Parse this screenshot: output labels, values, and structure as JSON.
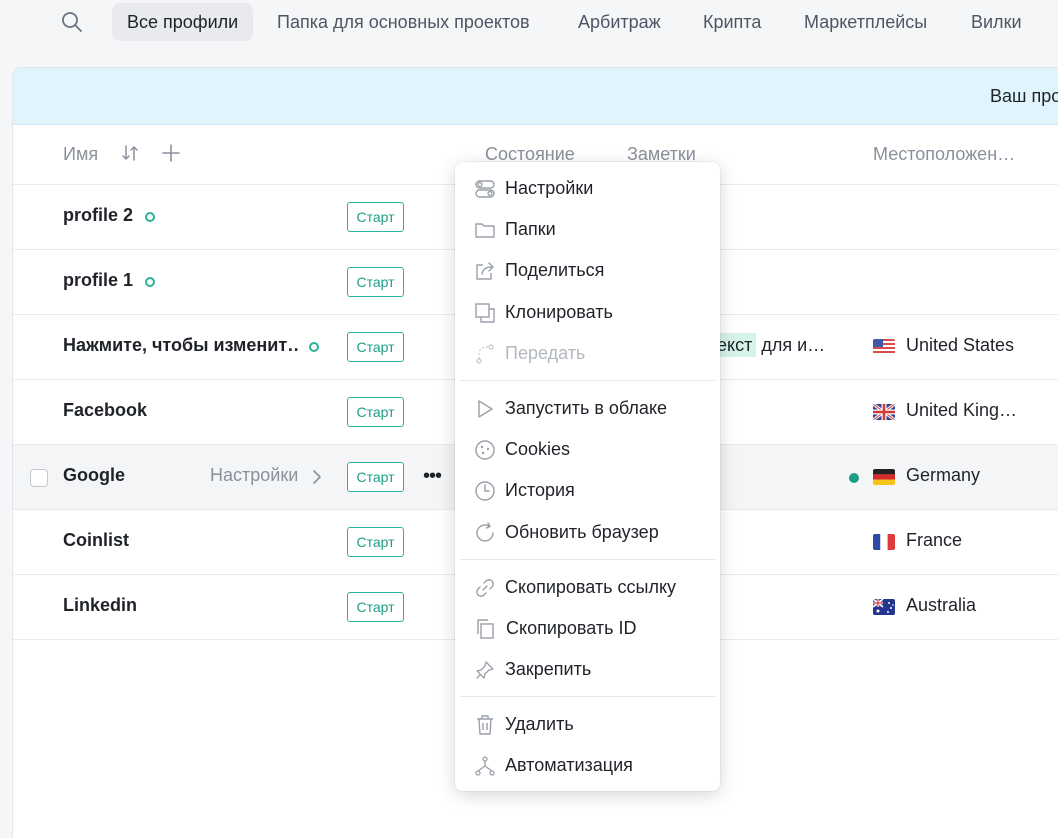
{
  "tabs": [
    {
      "label": "Все профили",
      "active": true
    },
    {
      "label": "Папка для основных проектов"
    },
    {
      "label": "Арбитраж"
    },
    {
      "label": "Крипта"
    },
    {
      "label": "Маркетплейсы"
    },
    {
      "label": "Вилки"
    }
  ],
  "banner": {
    "text": "Ваш про"
  },
  "table": {
    "headers": {
      "name": "Имя",
      "state": "Состояние",
      "notes": "Заметки",
      "location": "Местоположен…"
    },
    "start_label": "Старт",
    "row_settings_label": "Настройки",
    "more_label": "•••",
    "rows": [
      {
        "name": "profile 2",
        "location": ""
      },
      {
        "name": "profile 1",
        "location": ""
      },
      {
        "name": "Нажмите, чтобы изменит…",
        "note_highlight": "текст",
        "note_rest": " для и…",
        "location": "United States"
      },
      {
        "name": "Facebook",
        "location": "United King…"
      },
      {
        "name": "Google",
        "location": "Germany"
      },
      {
        "name": "Coinlist",
        "location": "France"
      },
      {
        "name": "Linkedin",
        "location": "Australia"
      }
    ]
  },
  "context_menu": {
    "items": [
      {
        "label": "Настройки",
        "icon": "settings-toggle-icon"
      },
      {
        "label": "Папки",
        "icon": "folder-icon"
      },
      {
        "label": "Поделиться",
        "icon": "share-icon"
      },
      {
        "label": "Клонировать",
        "icon": "clone-icon"
      },
      {
        "label": "Передать",
        "icon": "transfer-icon",
        "disabled": true
      },
      {
        "label": "Запустить в облаке",
        "icon": "play-icon"
      },
      {
        "label": "Cookies",
        "icon": "cookie-icon"
      },
      {
        "label": "История",
        "icon": "clock-icon"
      },
      {
        "label": "Обновить браузер",
        "icon": "refresh-icon"
      },
      {
        "label": "Скопировать ссылку",
        "icon": "link-icon"
      },
      {
        "label": "Скопировать ID",
        "icon": "copy-icon"
      },
      {
        "label": "Закрепить",
        "icon": "pin-icon"
      },
      {
        "label": "Удалить",
        "icon": "trash-icon"
      },
      {
        "label": "Автоматизация",
        "icon": "automation-icon"
      }
    ]
  },
  "colors": {
    "accent": "#2bb39a",
    "banner": "#dff4fd",
    "note_highlight": "#d6f3ea"
  }
}
